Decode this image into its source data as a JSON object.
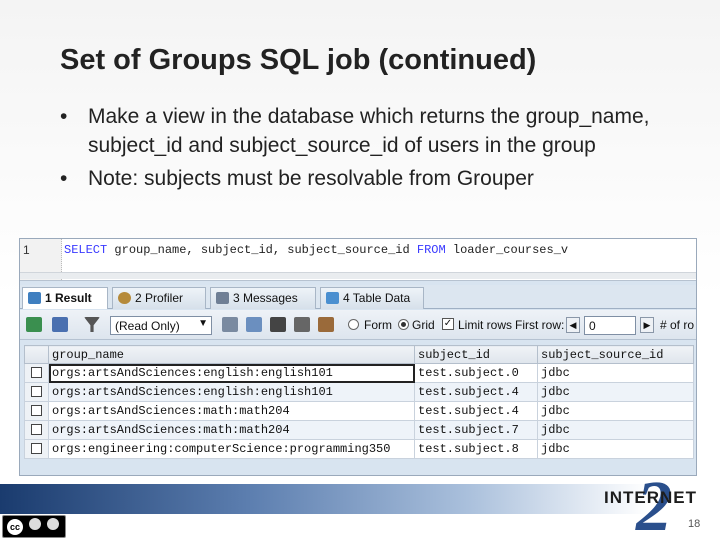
{
  "slide": {
    "title": "Set of Groups SQL job (continued)",
    "bullets": [
      "Make a view in the database which returns the group_name, subject_id and subject_source_id of users in the group",
      "Note: subjects must be resolvable from Grouper"
    ],
    "page_number": "18",
    "logo_text": "INTERNET",
    "logo_numeral": "2"
  },
  "editor": {
    "line_number": "1",
    "sql": {
      "kw_select": "SELECT",
      "columns": " group_name, subject_id, subject_source_id ",
      "kw_from": "FROM",
      "table": " loader_courses_v"
    }
  },
  "tabs": [
    {
      "label": "1 Result",
      "active": true
    },
    {
      "label": "2 Profiler",
      "active": false
    },
    {
      "label": "3 Messages",
      "active": false
    },
    {
      "label": "4 Table Data",
      "active": false
    }
  ],
  "toolbar": {
    "mode_select": "(Read Only)",
    "form_label": "Form",
    "grid_label": "Grid",
    "limit_rows_label": "Limit rows",
    "first_row_label": "First row:",
    "first_row_value": "0",
    "rows_label": "# of ro"
  },
  "grid": {
    "columns": [
      "group_name",
      "subject_id",
      "subject_source_id"
    ],
    "rows": [
      [
        "orgs:artsAndSciences:english:english101",
        "test.subject.0",
        "jdbc"
      ],
      [
        "orgs:artsAndSciences:english:english101",
        "test.subject.4",
        "jdbc"
      ],
      [
        "orgs:artsAndSciences:math:math204",
        "test.subject.4",
        "jdbc"
      ],
      [
        "orgs:artsAndSciences:math:math204",
        "test.subject.7",
        "jdbc"
      ],
      [
        "orgs:engineering:computerScience:programming350",
        "test.subject.8",
        "jdbc"
      ]
    ]
  },
  "colors": {
    "keyword": "#3a3aff",
    "logo_blue": "#2a4f8c",
    "footer_dark": "#1a3b6e"
  },
  "icons": [
    "result-grid-icon",
    "profiler-icon",
    "messages-icon",
    "table-data-icon",
    "export-icon",
    "filter-icon",
    "save-icon",
    "delete-icon",
    "nav-prev-icon",
    "nav-next-icon",
    "cc-by-nc-icon"
  ]
}
